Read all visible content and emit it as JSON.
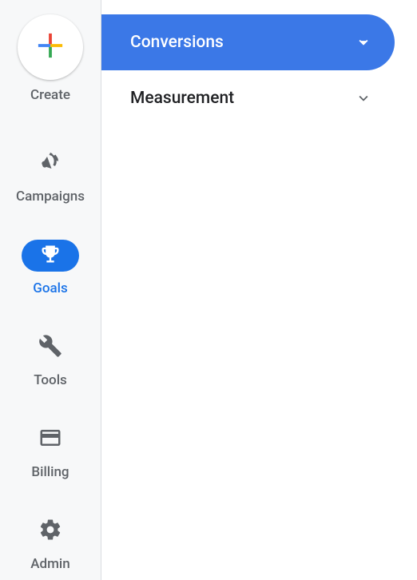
{
  "sidebar": {
    "create": {
      "label": "Create"
    },
    "items": [
      {
        "label": "Campaigns",
        "active": false
      },
      {
        "label": "Goals",
        "active": true
      },
      {
        "label": "Tools",
        "active": false
      },
      {
        "label": "Billing",
        "active": false
      },
      {
        "label": "Admin",
        "active": false
      }
    ]
  },
  "menu": {
    "items": [
      {
        "label": "Conversions",
        "selected": true
      },
      {
        "label": "Measurement",
        "selected": false
      }
    ]
  }
}
